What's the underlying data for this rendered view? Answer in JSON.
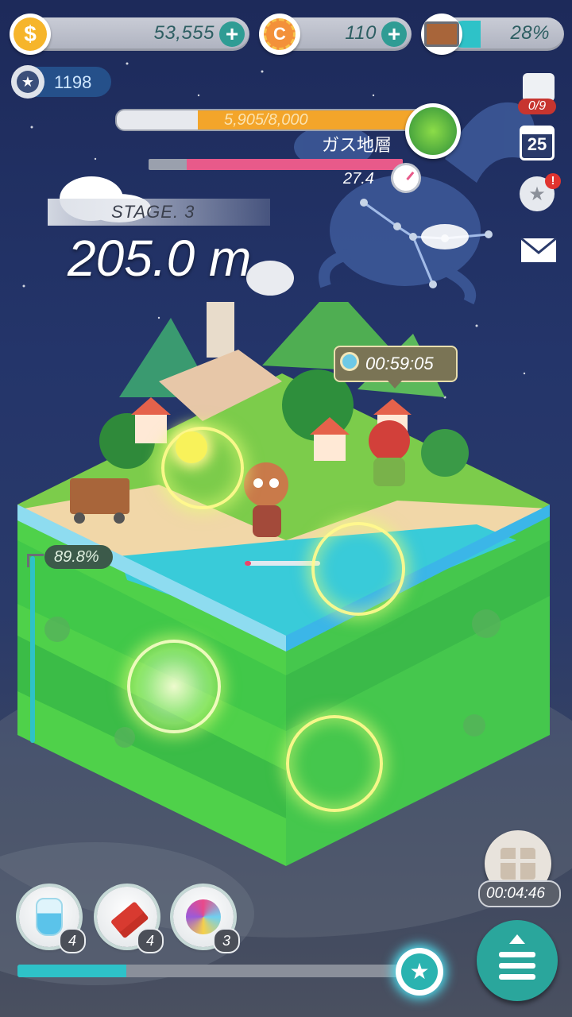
{
  "currency": {
    "coins": "53,555",
    "gems": "110",
    "cart_percent": "28%",
    "cart_fill": 0.28
  },
  "medal_count": "1198",
  "layer": {
    "progress_text": "5,905/8,000",
    "progress_fill": 0.738,
    "name": "ガス地層",
    "timer_value": "27.4",
    "timer_fill": 0.85
  },
  "stage": {
    "label": "STAGE. 3",
    "depth": "205.0 m"
  },
  "puzzle_count": "0/9",
  "calendar_day": "25",
  "quest_timer": "00:59:05",
  "dig_percent": "89.8%",
  "gift_timer": "00:04:46",
  "items": [
    {
      "name": "potion",
      "count": "4"
    },
    {
      "name": "dynamite",
      "count": "4"
    },
    {
      "name": "candy",
      "count": "3"
    }
  ],
  "bottom_progress_fill": 0.28,
  "colors": {
    "accent_teal": "#2f9c94",
    "layer_orange": "#f3a52a",
    "timer_pink": "#e85a8a"
  }
}
